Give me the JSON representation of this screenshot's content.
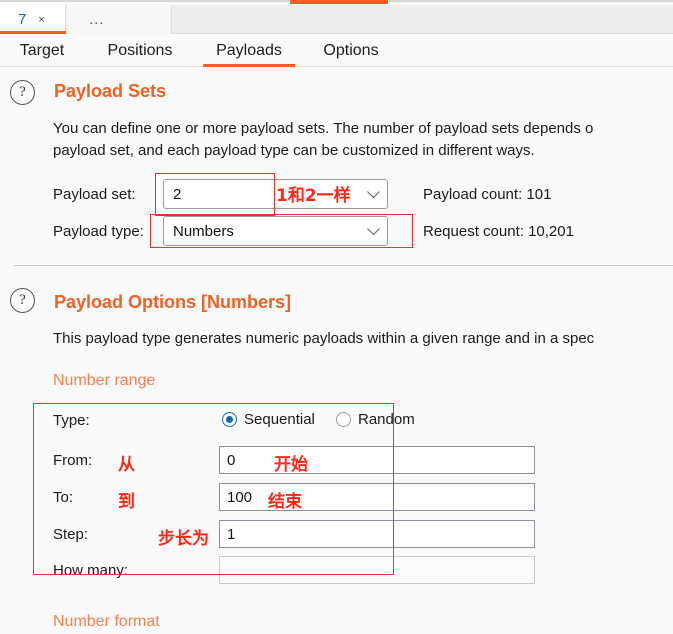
{
  "window_tabs": {
    "active_tab_label": "7",
    "close_glyph": "×",
    "overflow_label": "..."
  },
  "main_tabs": [
    {
      "label": "Target",
      "active": false
    },
    {
      "label": "Positions",
      "active": false
    },
    {
      "label": "Payloads",
      "active": true
    },
    {
      "label": "Options",
      "active": false
    }
  ],
  "payload_sets": {
    "help_icon_glyph": "?",
    "title": "Payload Sets",
    "description_line1": "You can define one or more payload sets. The number of payload sets depends o",
    "description_line2": "payload set, and each payload type can be customized in different ways.",
    "payload_set_label": "Payload set:",
    "payload_set_value": "2",
    "payload_type_label": "Payload type:",
    "payload_type_value": "Numbers",
    "payload_count_label": "Payload count:  101",
    "request_count_label": "Request count:  10,201",
    "chevron_icon": "chevron-down-icon"
  },
  "payload_options": {
    "help_icon_glyph": "?",
    "title": "Payload Options [Numbers]",
    "description": "This payload type generates numeric payloads within a given range and in a spec",
    "number_range_heading": "Number range",
    "number_format_heading": "Number format",
    "type_label": "Type:",
    "type_sequential": "Sequential",
    "type_random": "Random",
    "type_selected": "Sequential",
    "from_label": "From:",
    "from_value": "0",
    "to_label": "To:",
    "to_value": "100",
    "step_label": "Step:",
    "step_value": "1",
    "how_many_label": "How many:",
    "how_many_value": ""
  },
  "annotations": {
    "payload_set_note": "1和2一样",
    "from_note_label": "从",
    "from_note_value": "开始",
    "to_note_label": "到",
    "to_note_value": "结束",
    "step_note_label": "步长为"
  },
  "colors": {
    "accent_orange": "#f26122",
    "tab_underline": "#ff5b22",
    "annotation_red": "#fb2a18",
    "radio_blue": "#1466a8"
  }
}
